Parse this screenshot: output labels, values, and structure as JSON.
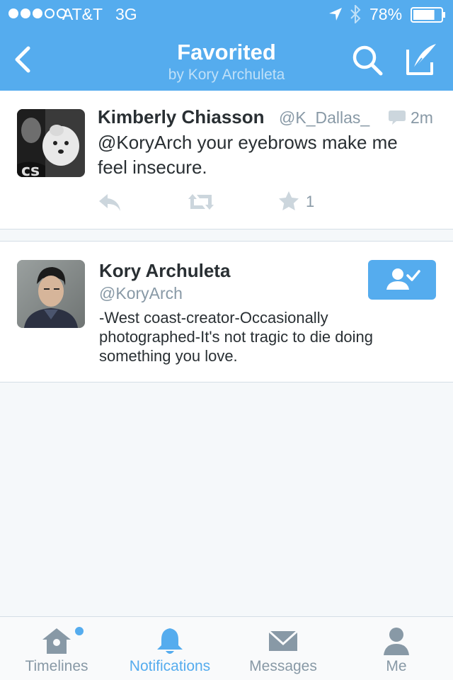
{
  "status_bar": {
    "carrier": "AT&T",
    "network": "3G",
    "signal_bars_filled": 3,
    "signal_bars_total": 5,
    "battery_percent": "78%",
    "battery_level": 0.78,
    "icons": [
      "location-arrow-icon",
      "bluetooth-icon",
      "battery-icon"
    ]
  },
  "nav": {
    "title": "Favorited",
    "subtitle": "by Kory Archuleta",
    "icons": [
      "back-chevron-icon",
      "search-icon",
      "compose-icon"
    ]
  },
  "tweet": {
    "author_name": "Kimberly Chiasson",
    "author_handle": "@K_Dallas_",
    "time": "2m",
    "text": "@KoryArch your eyebrows make me feel insecure.",
    "favorite_count": "1",
    "actions": [
      "reply-icon",
      "retweet-icon",
      "favorite-star-icon"
    ]
  },
  "user": {
    "name": "Kory Archuleta",
    "handle": "@KoryArch",
    "bio": "-West coast-creator-Occasionally photographed-It's not tragic to die doing something you love.",
    "follow_state_icon": "following-user-check-icon"
  },
  "tabs": [
    {
      "label": "Timelines",
      "icon": "home-icon",
      "active": false,
      "has_badge_dot": true
    },
    {
      "label": "Notifications",
      "icon": "bell-icon",
      "active": true,
      "has_badge_dot": false
    },
    {
      "label": "Messages",
      "icon": "envelope-icon",
      "active": false,
      "has_badge_dot": false
    },
    {
      "label": "Me",
      "icon": "person-icon",
      "active": false,
      "has_badge_dot": false
    }
  ],
  "colors": {
    "brand_blue": "#55acee",
    "text_dark": "#292f33",
    "text_muted": "#8899a6",
    "background": "#f5f8fa"
  }
}
